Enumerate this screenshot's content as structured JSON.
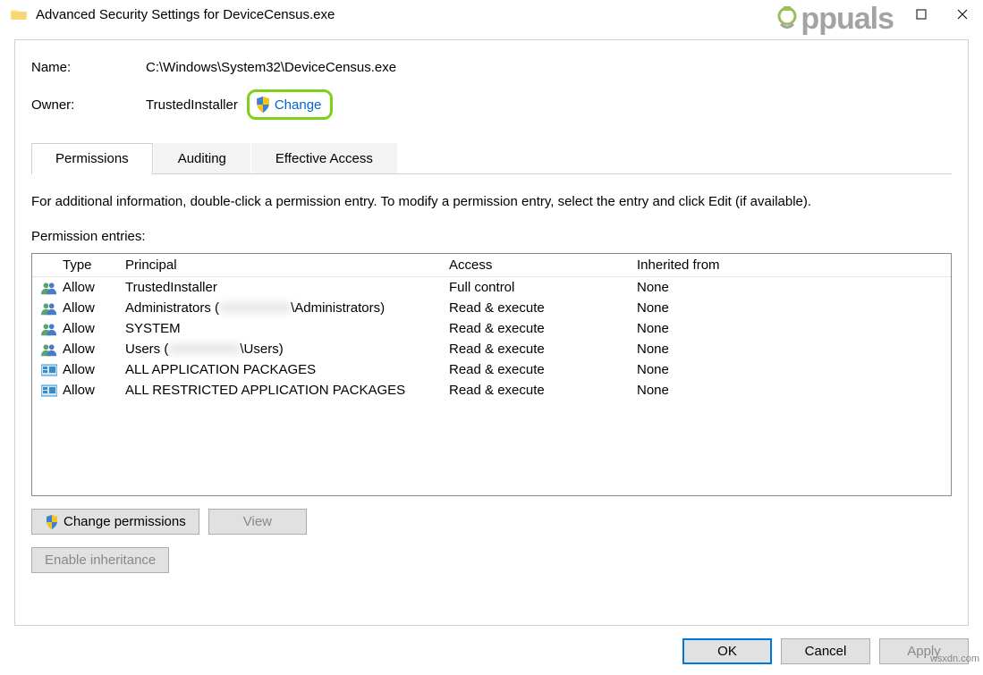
{
  "title": "Advanced Security Settings for DeviceCensus.exe",
  "watermark": "Appuals",
  "attribution": "wsxdn.com",
  "info": {
    "name_label": "Name:",
    "name_value": "C:\\Windows\\System32\\DeviceCensus.exe",
    "owner_label": "Owner:",
    "owner_value": "TrustedInstaller",
    "change_label": "Change"
  },
  "tabs": {
    "permissions": "Permissions",
    "auditing": "Auditing",
    "effective": "Effective Access"
  },
  "panel": {
    "instruction": "For additional information, double-click a permission entry. To modify a permission entry, select the entry and click Edit (if available).",
    "entries_label": "Permission entries:",
    "headers": {
      "type": "Type",
      "principal": "Principal",
      "access": "Access",
      "inherited": "Inherited from"
    },
    "rows": [
      {
        "icon": "users",
        "type": "Allow",
        "principal": "TrustedInstaller",
        "access": "Full control",
        "inherited": "None"
      },
      {
        "icon": "users",
        "type": "Allow",
        "principal_pre": "Administrators (",
        "principal_blur": "XXXXXXXX",
        "principal_post": "\\Administrators)",
        "access": "Read & execute",
        "inherited": "None"
      },
      {
        "icon": "users",
        "type": "Allow",
        "principal": "SYSTEM",
        "access": "Read & execute",
        "inherited": "None"
      },
      {
        "icon": "users",
        "type": "Allow",
        "principal_pre": "Users (",
        "principal_blur": "XXXXXXXX",
        "principal_post": "\\Users)",
        "access": "Read & execute",
        "inherited": "None"
      },
      {
        "icon": "package",
        "type": "Allow",
        "principal": "ALL APPLICATION PACKAGES",
        "access": "Read & execute",
        "inherited": "None"
      },
      {
        "icon": "package",
        "type": "Allow",
        "principal": "ALL RESTRICTED APPLICATION PACKAGES",
        "access": "Read & execute",
        "inherited": "None"
      }
    ]
  },
  "buttons": {
    "change_permissions": "Change permissions",
    "view": "View",
    "enable_inheritance": "Enable inheritance",
    "ok": "OK",
    "cancel": "Cancel",
    "apply": "Apply"
  }
}
